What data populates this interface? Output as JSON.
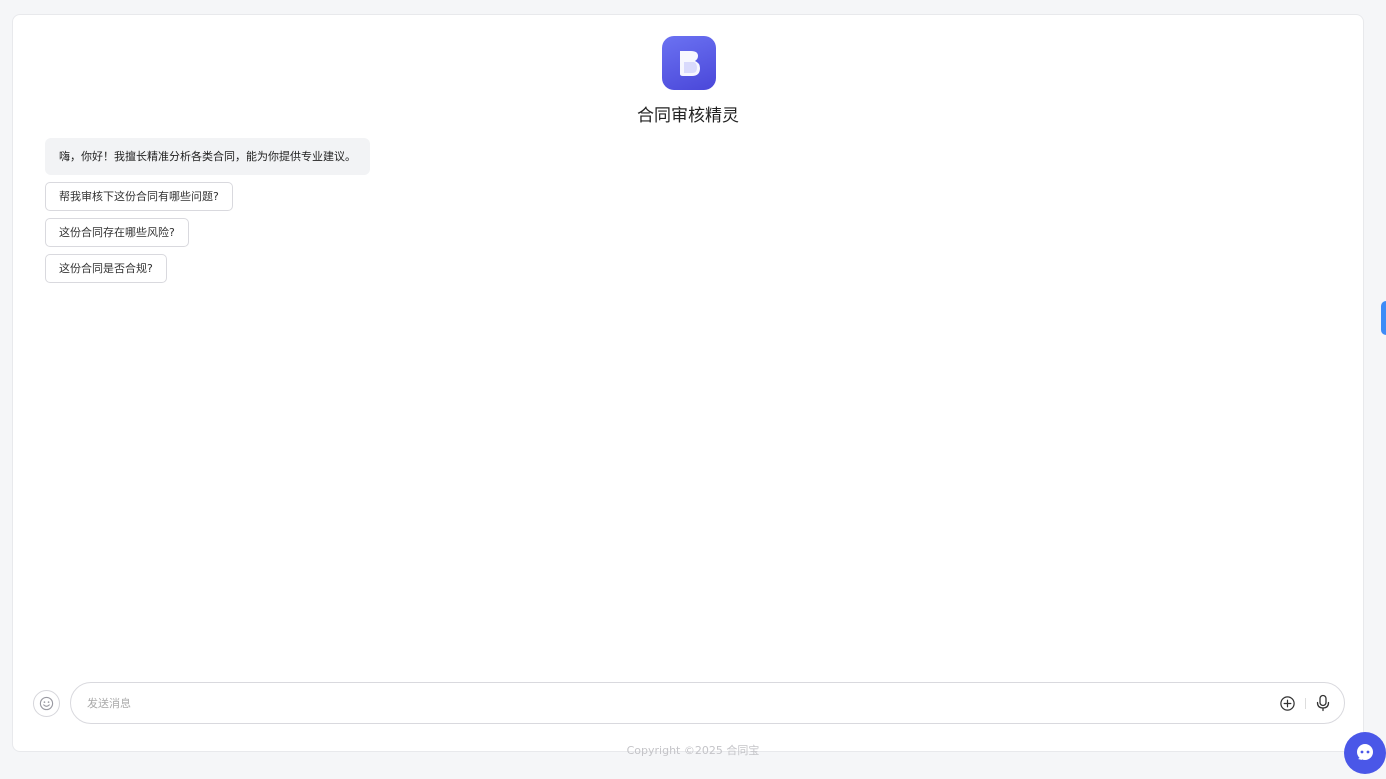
{
  "app": {
    "title": "合同审核精灵",
    "logo_icon": "app-logo-icon",
    "accent_color": "#5a5fe8"
  },
  "chat": {
    "greeting": "嗨，你好！我擅长精准分析各类合同，能为你提供专业建议。",
    "suggestions": [
      "帮我审核下这份合同有哪些问题?",
      "这份合同存在哪些风险?",
      "这份合同是否合规?"
    ]
  },
  "composer": {
    "placeholder": "发送消息",
    "emoji_icon": "smile-icon",
    "attach_icon": "plus-circle-icon",
    "voice_icon": "microphone-icon"
  },
  "footer": {
    "text": "Copyright ©2025 合同宝"
  },
  "floating": {
    "side_tab_icon": "side-tab-icon",
    "assistant_icon": "assistant-icon"
  }
}
